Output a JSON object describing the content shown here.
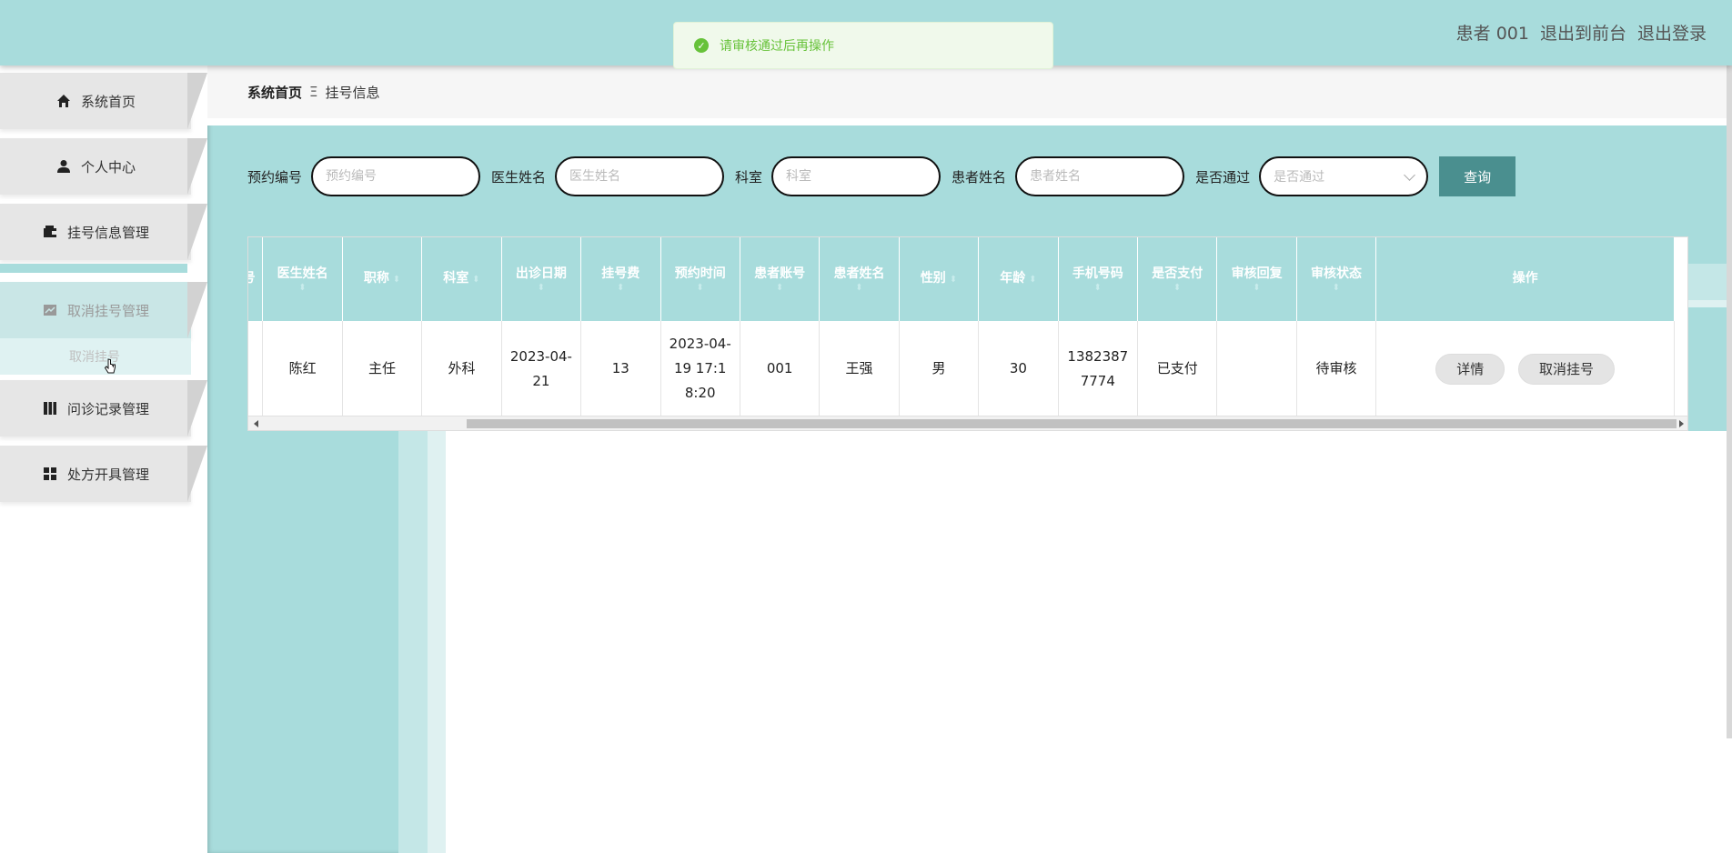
{
  "header": {
    "user": "患者 001",
    "to_front": "退出到前台",
    "logout": "退出登录"
  },
  "toast": {
    "message": "请审核通过后再操作"
  },
  "sidebar": {
    "items": [
      {
        "label": "系统首页",
        "icon": "home-icon"
      },
      {
        "label": "个人中心",
        "icon": "person-icon"
      },
      {
        "label": "挂号信息管理",
        "icon": "wallet-icon"
      },
      {
        "label": "取消挂号管理",
        "icon": "chart-icon"
      },
      {
        "label": "问诊记录管理",
        "icon": "book-icon"
      },
      {
        "label": "处方开具管理",
        "icon": "grid-icon"
      }
    ],
    "sub_item": "取消挂号"
  },
  "breadcrumb": {
    "home": "系统首页",
    "separator": "Ξ",
    "current": "挂号信息"
  },
  "search": {
    "fields": [
      {
        "label": "预约编号",
        "placeholder": "预约编号"
      },
      {
        "label": "医生姓名",
        "placeholder": "医生姓名"
      },
      {
        "label": "科室",
        "placeholder": "科室"
      },
      {
        "label": "患者姓名",
        "placeholder": "患者姓名"
      }
    ],
    "select": {
      "label": "是否通过",
      "placeholder": "是否通过"
    },
    "button": "查询"
  },
  "table": {
    "columns": [
      "号",
      "医生姓名",
      "职称",
      "科室",
      "出诊日期",
      "挂号费",
      "预约时间",
      "患者账号",
      "患者姓名",
      "性别",
      "年龄",
      "手机号码",
      "是否支付",
      "审核回复",
      "审核状态",
      "操作"
    ],
    "sort_glyph": "⬍",
    "rows": [
      {
        "cells": [
          "",
          "陈红",
          "主任",
          "外科",
          "2023-04-21",
          "13",
          "2023-04-19 17:18:20",
          "001",
          "王强",
          "男",
          "30",
          "13823877774",
          "已支付",
          "",
          "待审核"
        ],
        "actions": [
          "详情",
          "取消挂号"
        ]
      }
    ]
  },
  "colors": {
    "teal": "#a8dcdc",
    "button": "#4a8f8f",
    "success": "#67c23a"
  }
}
